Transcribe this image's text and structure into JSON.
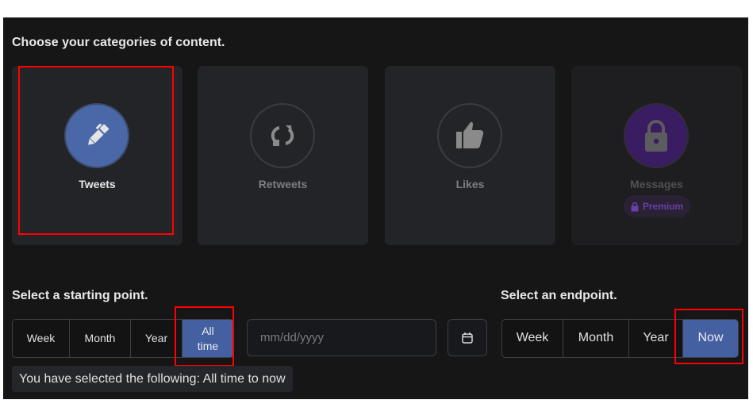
{
  "categories": {
    "heading": "Choose your categories of content.",
    "items": [
      {
        "label": "Tweets",
        "icon": "pen-icon",
        "selected": true
      },
      {
        "label": "Retweets",
        "icon": "retweet-icon",
        "selected": false
      },
      {
        "label": "Likes",
        "icon": "thumbs-up-icon",
        "selected": false
      },
      {
        "label": "Messages",
        "icon": "lock-icon",
        "selected": false,
        "badge": "Premium",
        "locked": true
      }
    ]
  },
  "start": {
    "heading": "Select a starting point.",
    "options": [
      "Week",
      "Month",
      "Year",
      "All time"
    ],
    "selected": "All time",
    "date_placeholder": "mm/dd/yyyy",
    "calendar_icon": "calendar-icon"
  },
  "end": {
    "heading": "Select an endpoint.",
    "options": [
      "Week",
      "Month",
      "Year",
      "Now"
    ],
    "selected": "Now"
  },
  "summary": "You have selected the following: All time to now",
  "colors": {
    "accent": "#4560a0",
    "premium": "#3a1c63",
    "highlight": "#ff0000",
    "background": "#161616",
    "card": "#232428"
  }
}
